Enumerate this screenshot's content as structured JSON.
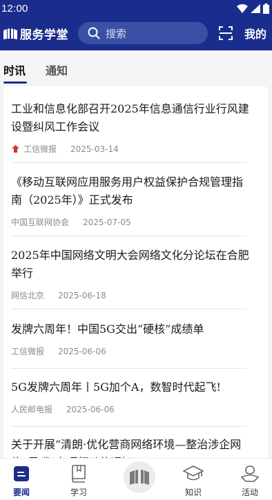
{
  "status": {
    "time": "12:00"
  },
  "header": {
    "logo_text": "服务学堂",
    "search_placeholder": "搜索",
    "mine_label": "我的"
  },
  "tabs": [
    {
      "label": "时讯",
      "active": true
    },
    {
      "label": "通知",
      "active": false
    }
  ],
  "news": [
    {
      "title": "工业和信息化部召开2025年信息通信行业行风建设暨纠风工作会议",
      "source": "工信微报",
      "date": "2025-03-14",
      "has_icon": true
    },
    {
      "title": "《移动互联网应用服务用户权益保护合规管理指南（2025年）》正式发布",
      "source": "中国互联网协会",
      "date": "2025-07-05"
    },
    {
      "title": "2025年中国网络文明大会网络文化分论坛在合肥举行",
      "source": "网信北京",
      "date": "2025-06-18"
    },
    {
      "title": "发牌六周年！中国5G交出“硬核”成绩单",
      "source": "工信微报",
      "date": "2025-06-06"
    },
    {
      "title": "5G发牌六周年丨5G加个A，数智时代起飞!",
      "source": "人民邮电报",
      "date": "2025-06-06"
    },
    {
      "title": "关于开展“清朗·优化营商网络环境—整治涉企网络“黑嘴”专项行动的通知",
      "source": "",
      "date": ""
    }
  ],
  "bottom_nav": [
    {
      "label": "要闻",
      "active": true
    },
    {
      "label": "学习",
      "active": false
    },
    {
      "label": "知识",
      "active": false
    },
    {
      "label": "活动",
      "active": false
    }
  ],
  "colors": {
    "brand": "#1a2d8c",
    "search_bg": "#3a4fa5"
  }
}
